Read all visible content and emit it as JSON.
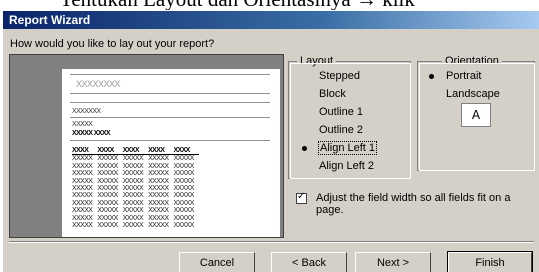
{
  "background_heading": "Tentukan Layout dan Orientasinya → klik",
  "window": {
    "title": "Report Wizard",
    "question": "How would you like to lay out your report?"
  },
  "preview": {
    "title_text": "XXXXXXXX",
    "group_lines": [
      "XXXXXXX",
      "XXXXX",
      "XXXXX XXXX"
    ],
    "columns": [
      "XXXX",
      "XXXX",
      "XXXX",
      "XXXX",
      "XXXX"
    ],
    "cell_text": "XXXXX",
    "row_count": 10
  },
  "layout": {
    "caption": "Layout",
    "options": [
      {
        "label": "Stepped",
        "selected": false
      },
      {
        "label": "Block",
        "selected": false
      },
      {
        "label": "Outline 1",
        "selected": false
      },
      {
        "label": "Outline 2",
        "selected": false
      },
      {
        "label": "Align Left 1",
        "selected": true
      },
      {
        "label": "Align Left 2",
        "selected": false
      }
    ]
  },
  "orientation": {
    "caption": "Orientation",
    "options": [
      {
        "label": "Portrait",
        "selected": true
      },
      {
        "label": "Landscape",
        "selected": false
      }
    ],
    "icon_letter": "A"
  },
  "adjust_width": {
    "checked": true,
    "label": "Adjust the field width so all fields fit on a page."
  },
  "buttons": {
    "cancel": "Cancel",
    "back": "< Back",
    "next": "Next >",
    "finish": "Finish"
  },
  "colors": {
    "dialog_bg": "#d4d0c8",
    "titlebar_start": "#0a246a",
    "titlebar_end": "#a6caf0",
    "preview_bg": "#808080"
  }
}
